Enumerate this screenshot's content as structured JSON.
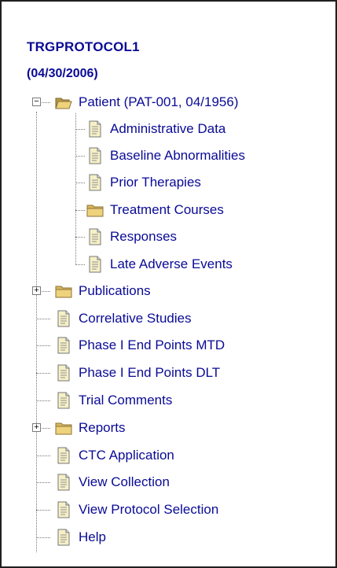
{
  "header": {
    "title": "TRGPROTOCOL1",
    "date": "(04/30/2006)"
  },
  "tree": {
    "patient": {
      "label": "Patient (PAT-001, 04/1956)",
      "expanded": true,
      "icon": "open-folder-icon"
    },
    "patient_children": [
      {
        "label": "Administrative Data",
        "icon": "document-icon"
      },
      {
        "label": "Baseline Abnormalities",
        "icon": "document-icon"
      },
      {
        "label": "Prior Therapies",
        "icon": "document-icon"
      },
      {
        "label": "Treatment Courses",
        "icon": "folder-icon"
      },
      {
        "label": "Responses",
        "icon": "document-icon"
      },
      {
        "label": "Late Adverse Events",
        "icon": "document-icon"
      }
    ],
    "top_level": [
      {
        "label": "Publications",
        "icon": "folder-icon",
        "expandable": true
      },
      {
        "label": "Correlative Studies",
        "icon": "document-icon"
      },
      {
        "label": "Phase I End Points MTD",
        "icon": "document-icon"
      },
      {
        "label": "Phase I End Points DLT",
        "icon": "document-icon"
      },
      {
        "label": "Trial Comments",
        "icon": "document-icon"
      },
      {
        "label": "Reports",
        "icon": "folder-icon",
        "expandable": true
      },
      {
        "label": "CTC Application",
        "icon": "document-icon"
      },
      {
        "label": "View Collection",
        "icon": "document-icon"
      },
      {
        "label": "View Protocol Selection",
        "icon": "document-icon"
      },
      {
        "label": "Help",
        "icon": "document-icon"
      }
    ]
  },
  "colors": {
    "link": "#0a0a96",
    "folder": "#e9d27a",
    "document": "#f4efc2"
  }
}
